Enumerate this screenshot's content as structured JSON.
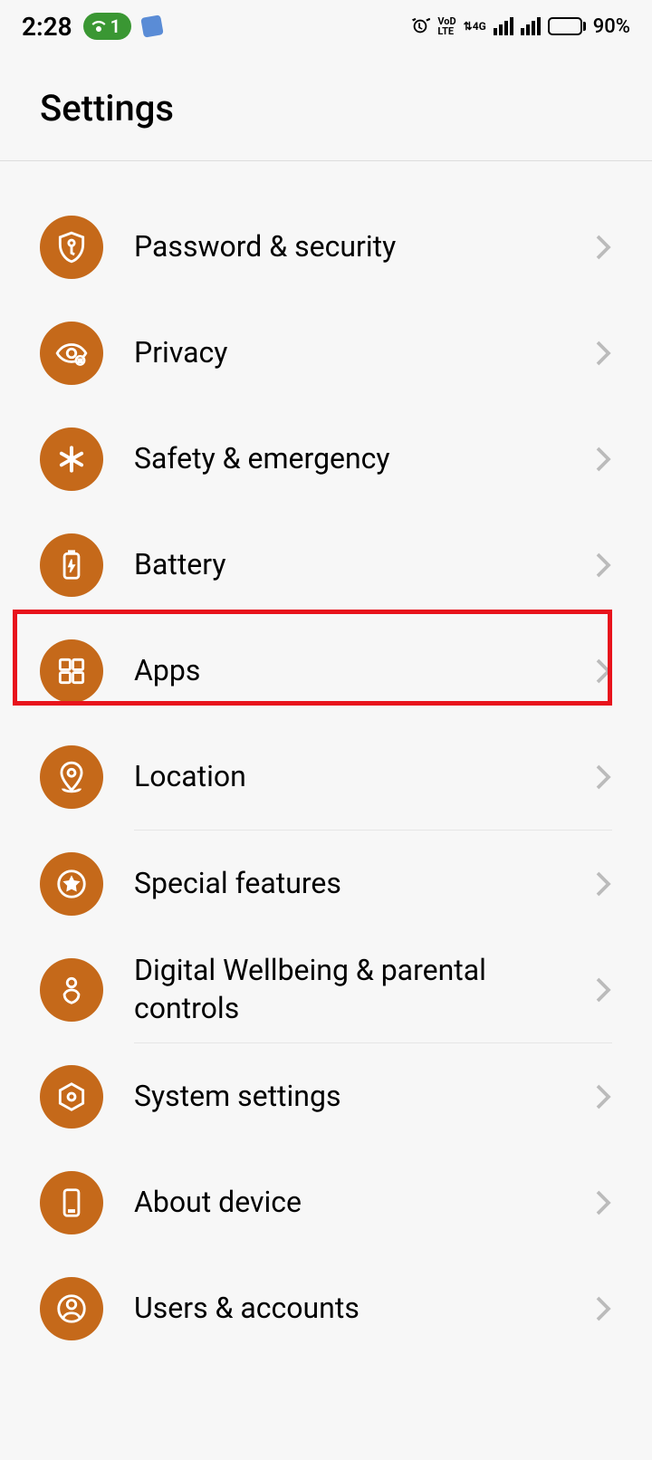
{
  "status": {
    "time": "2:28",
    "badge_count": "1",
    "battery_pct": "90%",
    "network_label": "4G",
    "volte_label": "VoLTE"
  },
  "header": {
    "title": "Settings"
  },
  "items": [
    {
      "label": "Password & security",
      "icon": "shield-key"
    },
    {
      "label": "Privacy",
      "icon": "eye-lock"
    },
    {
      "label": "Safety & emergency",
      "icon": "asterisk"
    },
    {
      "label": "Battery",
      "icon": "battery-charge"
    },
    {
      "label": "Apps",
      "icon": "grid"
    },
    {
      "label": "Location",
      "icon": "map-pin"
    },
    {
      "label": "Special features",
      "icon": "star-circle"
    },
    {
      "label": "Digital Wellbeing & parental controls",
      "icon": "heart-person"
    },
    {
      "label": "System settings",
      "icon": "hexagon-dot"
    },
    {
      "label": "About device",
      "icon": "phone"
    },
    {
      "label": "Users & accounts",
      "icon": "person-circle"
    }
  ],
  "highlight_index": 4,
  "accent_color": "#c5691a"
}
